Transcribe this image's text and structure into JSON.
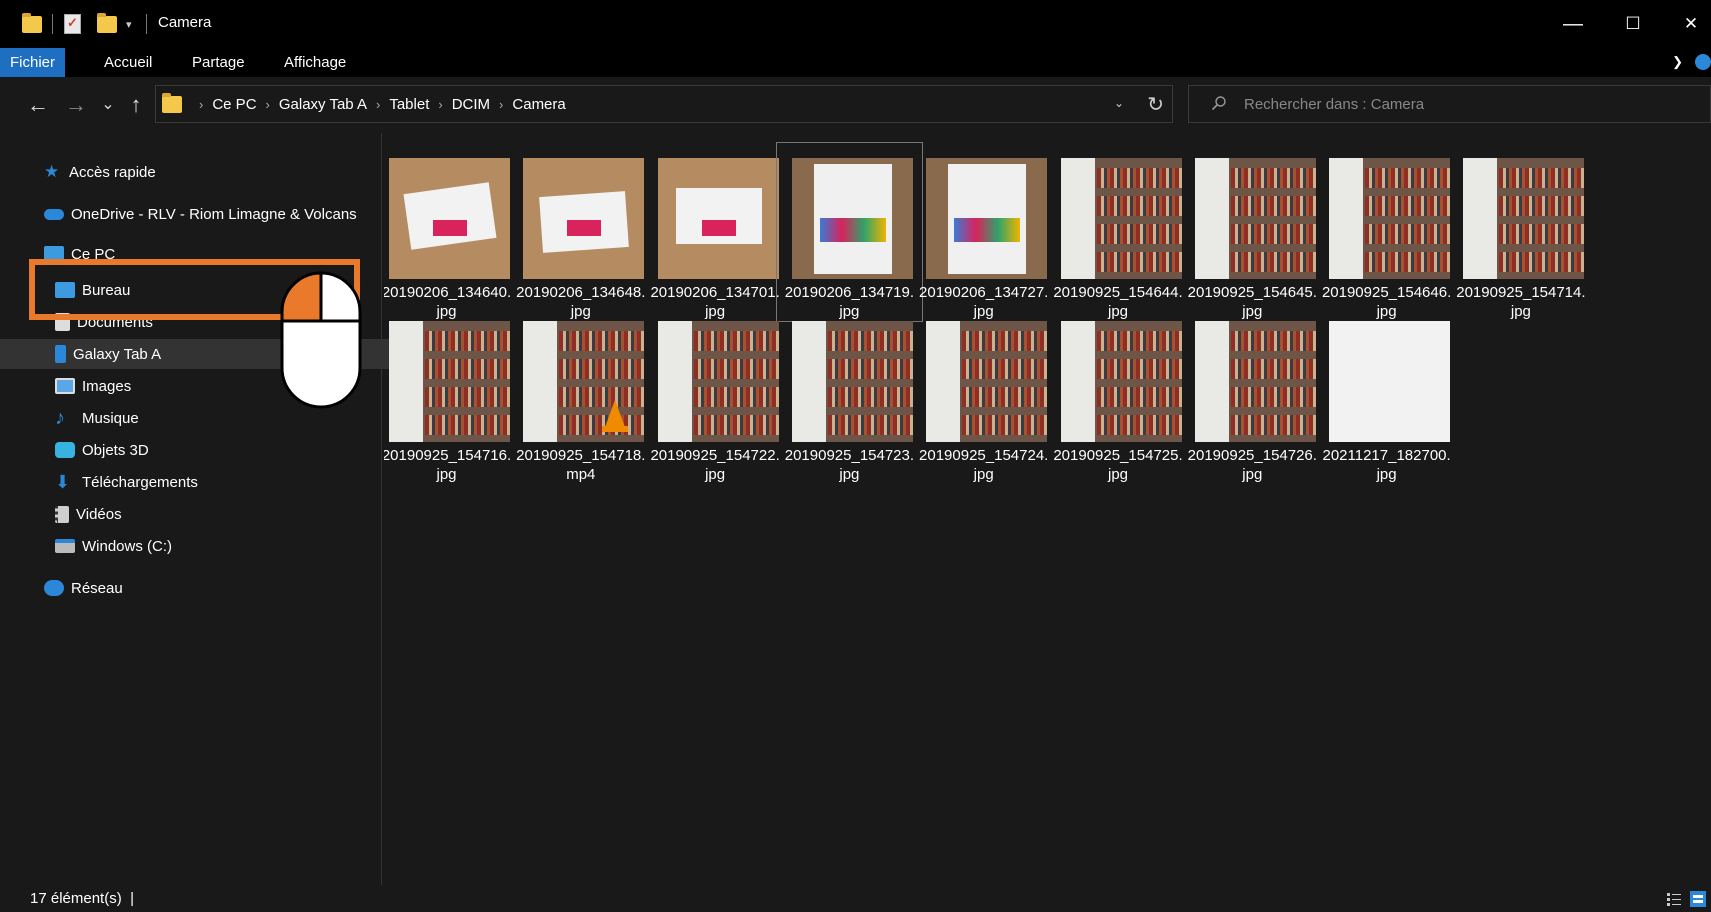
{
  "titlebar": {
    "title": "Camera",
    "minimize": "—",
    "maximize": "☐",
    "close": "✕"
  },
  "ribbon": {
    "tabs": [
      "Fichier",
      "Accueil",
      "Partage",
      "Affichage"
    ],
    "active_index": 0,
    "accent": "#1e6fc2"
  },
  "addressbar": {
    "back": "←",
    "forward": "→",
    "recent": "⌄",
    "up": "↑",
    "breadcrumb": [
      "Ce PC",
      "Galaxy Tab A",
      "Tablet",
      "DCIM",
      "Camera"
    ],
    "dropdown": "⌄",
    "refresh": "↻"
  },
  "search": {
    "placeholder": "Rechercher dans : Camera"
  },
  "navpane": {
    "items": [
      {
        "label": "Accès rapide",
        "icon": "star-icon",
        "indent": 0
      },
      {
        "label": "OneDrive - RLV - Riom Limagne & Volcans",
        "icon": "cloud-icon",
        "indent": 0
      },
      {
        "label": "Ce PC",
        "icon": "computer-icon",
        "indent": 0
      },
      {
        "label": "Bureau",
        "icon": "desktop-icon",
        "indent": 1
      },
      {
        "label": "Documents",
        "icon": "documents-icon",
        "indent": 1
      },
      {
        "label": "Galaxy Tab A",
        "icon": "tablet-icon",
        "indent": 1,
        "selected": true
      },
      {
        "label": "Images",
        "icon": "images-icon",
        "indent": 1
      },
      {
        "label": "Musique",
        "icon": "music-icon",
        "indent": 1
      },
      {
        "label": "Objets 3D",
        "icon": "cube-icon",
        "indent": 1
      },
      {
        "label": "Téléchargements",
        "icon": "download-icon",
        "indent": 1
      },
      {
        "label": "Vidéos",
        "icon": "video-icon",
        "indent": 1
      },
      {
        "label": "Windows (C:)",
        "icon": "drive-icon",
        "indent": 1
      },
      {
        "label": "Réseau",
        "icon": "network-icon",
        "indent": 0
      }
    ]
  },
  "files": [
    {
      "name": "20190206_134640.",
      "ext": "jpg",
      "thumb": "card"
    },
    {
      "name": "20190206_134648.",
      "ext": "jpg",
      "thumb": "card"
    },
    {
      "name": "20190206_134701.",
      "ext": "jpg",
      "thumb": "card"
    },
    {
      "name": "20190206_134719.",
      "ext": "jpg",
      "thumb": "flyer"
    },
    {
      "name": "20190206_134727.",
      "ext": "jpg",
      "thumb": "flyer"
    },
    {
      "name": "20190925_154644.",
      "ext": "jpg",
      "thumb": "shelf"
    },
    {
      "name": "20190925_154645.",
      "ext": "jpg",
      "thumb": "shelf"
    },
    {
      "name": "20190925_154646.",
      "ext": "jpg",
      "thumb": "shelf"
    },
    {
      "name": "20190925_154714.",
      "ext": "jpg",
      "thumb": "shelf"
    },
    {
      "name": "20190925_154716.",
      "ext": "jpg",
      "thumb": "shelf"
    },
    {
      "name": "20190925_154718.",
      "ext": "mp4",
      "thumb": "video"
    },
    {
      "name": "20190925_154722.",
      "ext": "jpg",
      "thumb": "shelf"
    },
    {
      "name": "20190925_154723.",
      "ext": "jpg",
      "thumb": "shelf"
    },
    {
      "name": "20190925_154724.",
      "ext": "jpg",
      "thumb": "shelf"
    },
    {
      "name": "20190925_154725.",
      "ext": "jpg",
      "thumb": "shelf"
    },
    {
      "name": "20190925_154726.",
      "ext": "jpg",
      "thumb": "shelf"
    },
    {
      "name": "20211217_182700.",
      "ext": "jpg",
      "thumb": "blank"
    }
  ],
  "statusbar": {
    "count": "17 élément(s)",
    "separator": "|"
  },
  "overlay": {
    "highlight_color": "#ea7a2b",
    "highlight_target": "Bureau"
  }
}
